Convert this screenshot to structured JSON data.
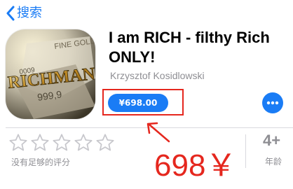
{
  "nav": {
    "back_label": "搜索",
    "back_icon": "chevron-left-icon"
  },
  "app": {
    "title": "I am RICH - filthy Rich ONLY!",
    "developer": "Krzysztof Kosidlowski",
    "price": "¥698.00",
    "icon_text": "RICHMAN",
    "icon_bar_text": "FINE GOLD",
    "icon_bar_purity": "999,9",
    "icon_bar_digits": "0009"
  },
  "ratings": {
    "stars_filled": 0,
    "stars_total": 5,
    "label": "没有足够的评分"
  },
  "age": {
    "value": "4+",
    "label": "年龄"
  },
  "annotation": {
    "text": "698￥"
  },
  "colors": {
    "accent": "#1a7cf5",
    "annotation": "#e5271e",
    "gold": "#d4a32a",
    "secondary_text": "#8e8e93"
  }
}
